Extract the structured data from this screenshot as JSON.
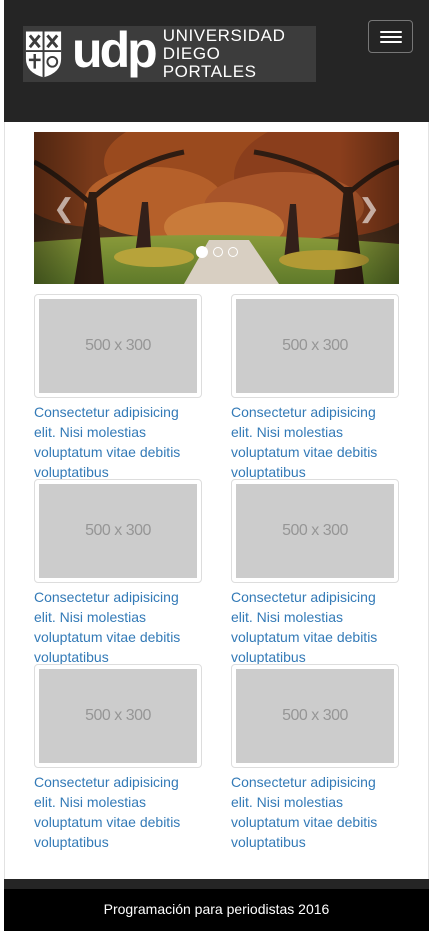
{
  "header": {
    "logo_mark": "udp",
    "logo_line1": "UNIVERSIDAD",
    "logo_line2": "DIEGO PORTALES",
    "menu_icon": "hamburger-menu-icon"
  },
  "carousel": {
    "prev_symbol": "❮",
    "next_symbol": "❯",
    "slides": 3,
    "active_slide": 1
  },
  "cards": [
    {
      "placeholder": "500 x 300",
      "caption": "Consectetur adipisicing elit. Nisi molestias voluptatum vitae debitis voluptatibus"
    },
    {
      "placeholder": "500 x 300",
      "caption": "Consectetur adipisicing elit. Nisi molestias voluptatum vitae debitis voluptatibus"
    },
    {
      "placeholder": "500 x 300",
      "caption": "Consectetur adipisicing elit. Nisi molestias voluptatum vitae debitis voluptatibus"
    },
    {
      "placeholder": "500 x 300",
      "caption": "Consectetur adipisicing elit. Nisi molestias voluptatum vitae debitis voluptatibus"
    },
    {
      "placeholder": "500 x 300",
      "caption": "Consectetur adipisicing elit. Nisi molestias voluptatum vitae debitis voluptatibus"
    },
    {
      "placeholder": "500 x 300",
      "caption": "Consectetur adipisicing elit. Nisi molestias voluptatum vitae debitis voluptatibus"
    }
  ],
  "footer": {
    "text": "Programación para periodistas 2016"
  },
  "colors": {
    "navbar": "#252525",
    "link": "#337ab7",
    "placeholder": "#cccccc",
    "footer": "#000000"
  }
}
